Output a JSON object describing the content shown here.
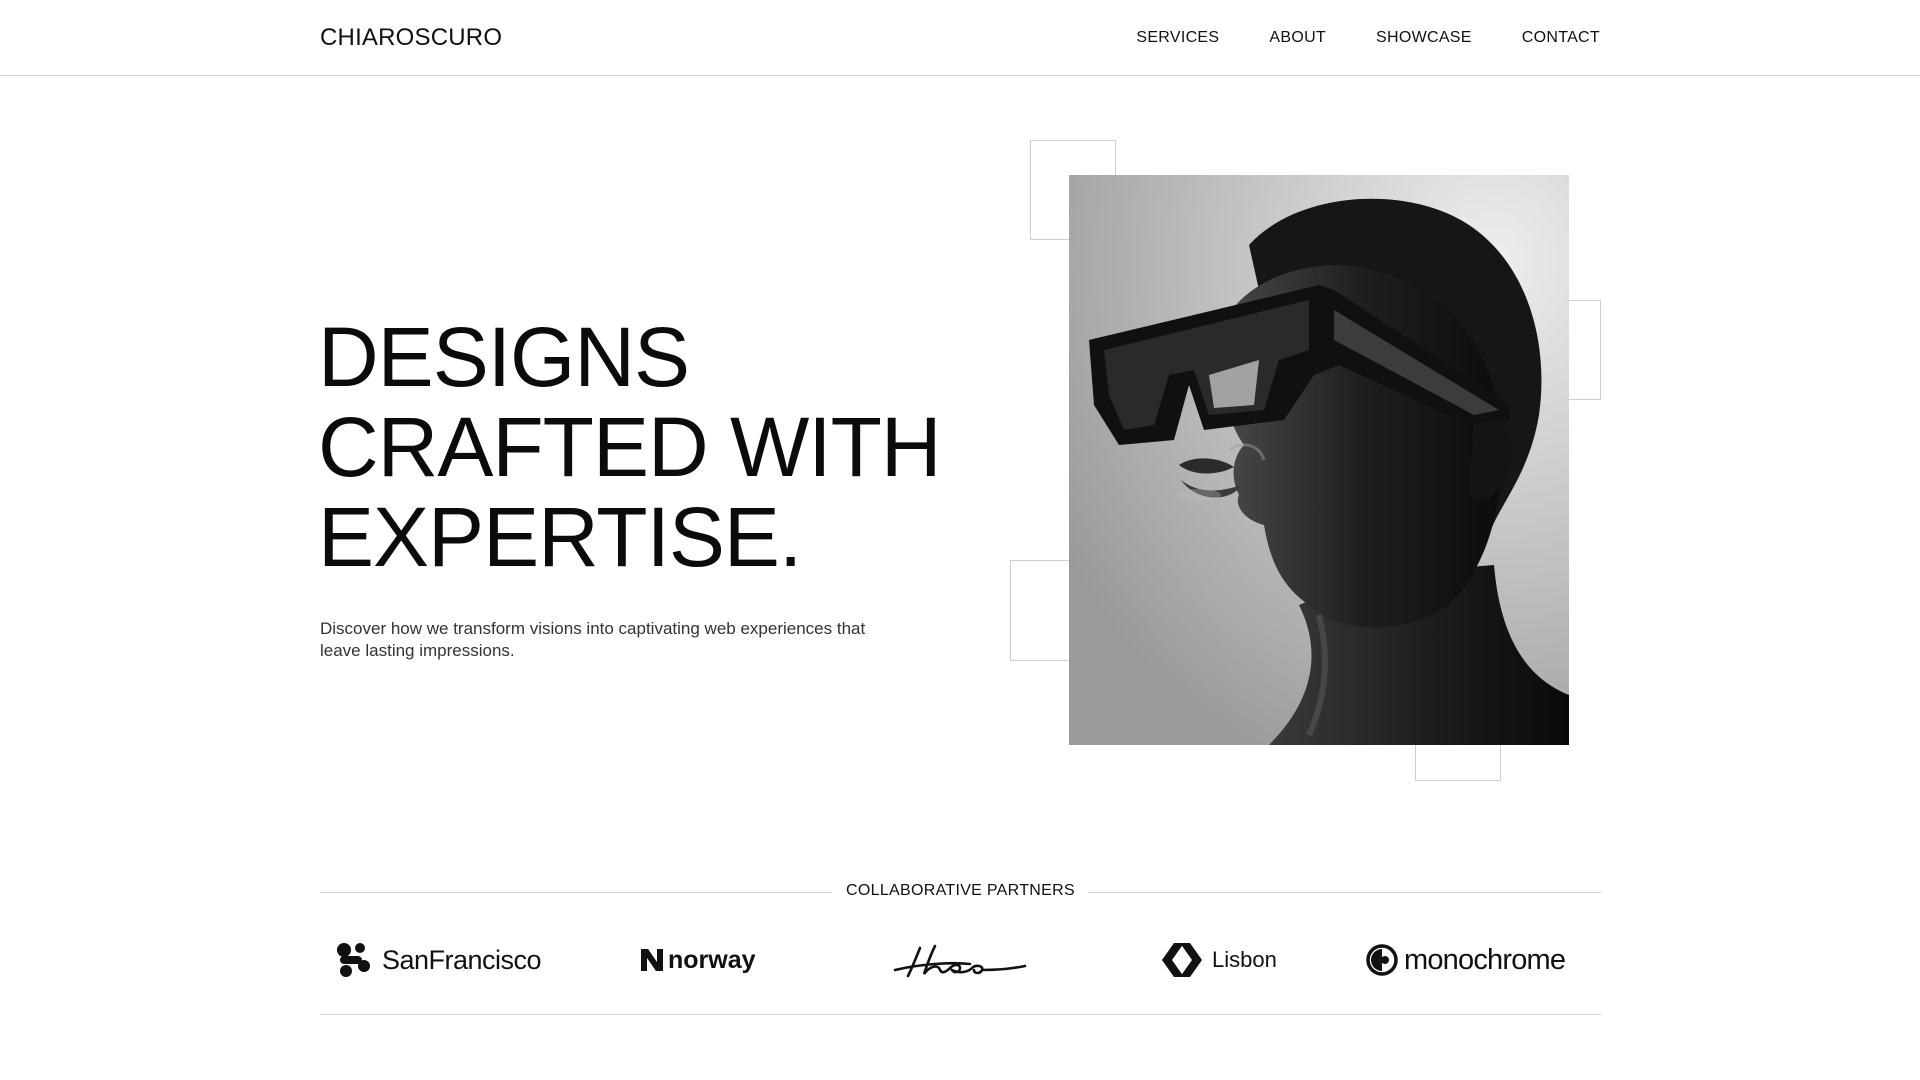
{
  "header": {
    "brand": "CHIAROSCURO",
    "nav": [
      "SERVICES",
      "ABOUT",
      "SHOWCASE",
      "CONTACT"
    ]
  },
  "hero": {
    "title_lines": [
      "DESIGNS",
      "CRAFTED WITH",
      "EXPERTISE."
    ],
    "subtitle": "Discover how we transform visions into captivating web experiences that leave lasting impressions.",
    "image_icon": "portrait-photo"
  },
  "partners": {
    "label": "COLLABORATIVE PARTNERS",
    "logos": [
      {
        "name": "SanFrancisco",
        "icon": "sanfrancisco-logo-icon"
      },
      {
        "name": "norway",
        "icon": "norway-logo-icon"
      },
      {
        "name": "theo",
        "icon": "theo-signature-logo"
      },
      {
        "name": "Lisbon",
        "icon": "lisbon-logo-icon"
      },
      {
        "name": "monochrome",
        "icon": "monochrome-logo-icon"
      }
    ]
  },
  "colors": {
    "background": "#ffffff",
    "text": "#111111",
    "divider": "#d4d4d4"
  }
}
